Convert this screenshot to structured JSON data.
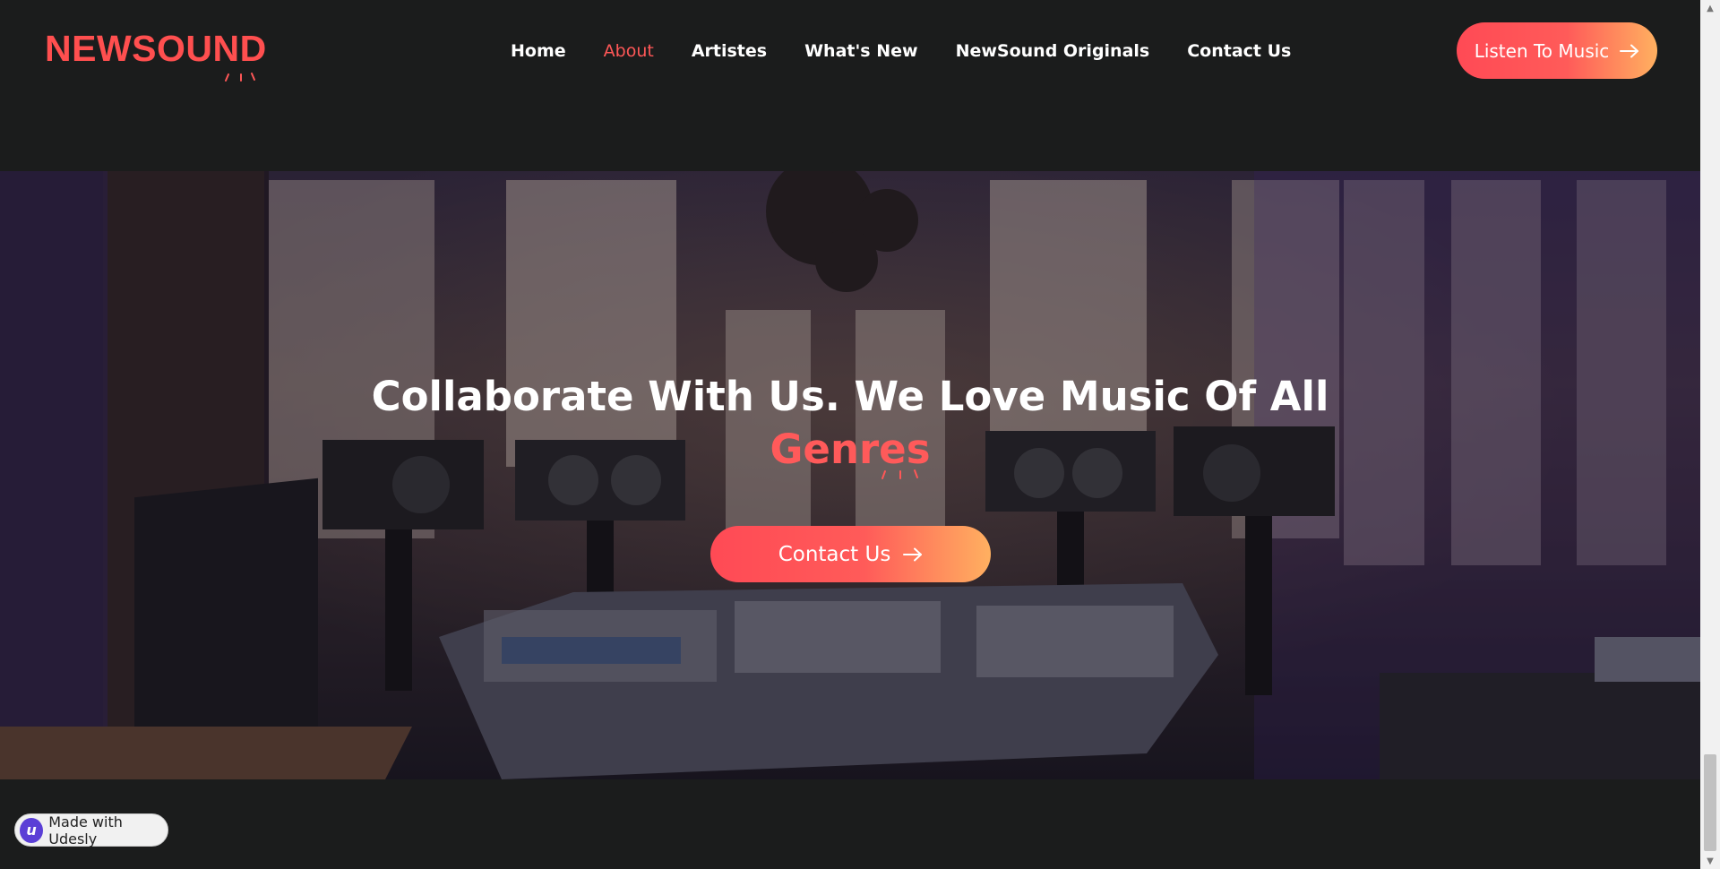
{
  "brand": {
    "name": "NEWSOUND",
    "accent": "#ff4f4f"
  },
  "nav": {
    "items": [
      {
        "label": "Home"
      },
      {
        "label": "About"
      },
      {
        "label": "Artistes"
      },
      {
        "label": "What's New"
      },
      {
        "label": "NewSound Originals"
      },
      {
        "label": "Contact Us"
      }
    ],
    "active": "About"
  },
  "header": {
    "cta_label": "Listen To Music",
    "cta_icon": "arrow-right-icon"
  },
  "hero": {
    "title_line1": "Collaborate With Us. We Love Music Of All",
    "title_accent": "Genres",
    "cta_label": "Contact Us",
    "cta_icon": "arrow-right-icon",
    "background": "music-studio-photo"
  },
  "badge": {
    "label": "Made with Udesly",
    "logo_letter": "u"
  },
  "colors": {
    "background": "#1b1c1c",
    "gradient_start": "#ff4a55",
    "gradient_end": "#ffb060",
    "text": "#ffffff"
  }
}
